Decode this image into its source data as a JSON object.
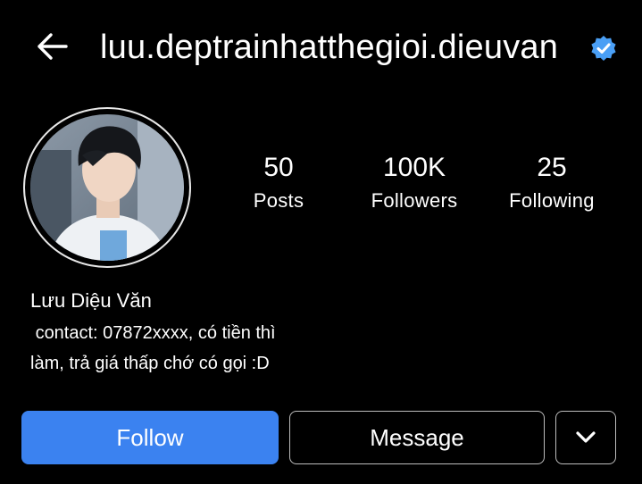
{
  "header": {
    "back_icon": "arrow-left-icon",
    "username": "luu.deptrainhatthegioi.dieuvan",
    "verified_icon": "verified-badge-icon"
  },
  "profile": {
    "stats": [
      {
        "value": "50",
        "label": "Posts"
      },
      {
        "value": "100K",
        "label": "Followers"
      },
      {
        "value": "25",
        "label": "Following"
      }
    ],
    "name": "Lưu Diệu Văn",
    "bio": " contact: 07872xxxx, có tiền thì\nlàm, trả giá thấp chớ có gọi :D"
  },
  "actions": {
    "follow_label": "Follow",
    "message_label": "Message",
    "more_icon": "chevron-down-icon"
  },
  "colors": {
    "background": "#000000",
    "follow_button": "#3b82f0",
    "verified": "#4a9ff5"
  }
}
